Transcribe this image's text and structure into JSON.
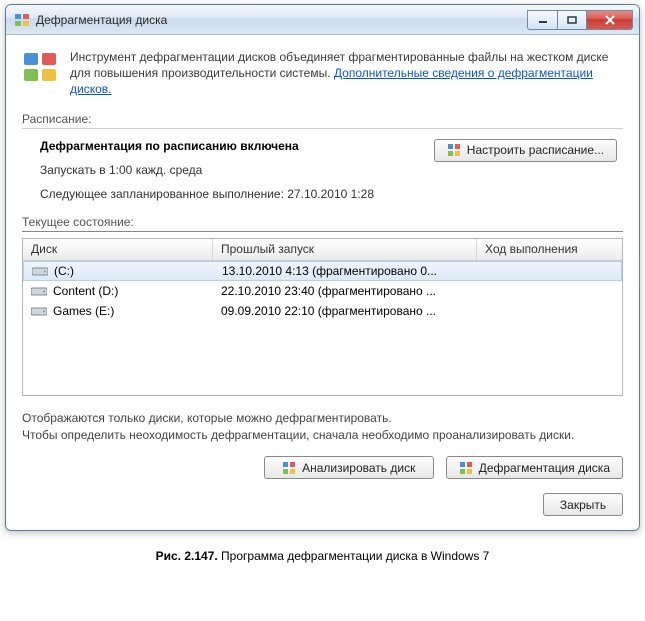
{
  "window": {
    "title": "Дефрагментация диска"
  },
  "intro": {
    "text": "Инструмент дефрагментации дисков объединяет фрагментированные файлы на жестком диске для повышения производительности системы. ",
    "link": "Дополнительные сведения о дефрагментации дисков."
  },
  "schedule": {
    "section_label": "Расписание:",
    "title": "Дефрагментация по расписанию включена",
    "run_line": "Запускать в 1:00 кажд. среда",
    "next_line": "Следующее запланированное выполнение: 27.10.2010 1:28",
    "config_button": "Настроить расписание..."
  },
  "status": {
    "section_label": "Текущее состояние:",
    "columns": {
      "disk": "Диск",
      "last": "Прошлый запуск",
      "progress": "Ход выполнения"
    },
    "rows": [
      {
        "name": "(C:)",
        "icon": "drive",
        "last": "13.10.2010 4:13 (фрагментировано 0...",
        "progress": "",
        "selected": true
      },
      {
        "name": "Content (D:)",
        "icon": "drive",
        "last": "22.10.2010 23:40 (фрагментировано ...",
        "progress": "",
        "selected": false
      },
      {
        "name": "Games (E:)",
        "icon": "drive",
        "last": "09.09.2010 22:10 (фрагментировано ...",
        "progress": "",
        "selected": false
      }
    ]
  },
  "hint": {
    "line1": "Отображаются только диски, которые можно дефрагментировать.",
    "line2": "Чтобы определить неоходимость  дефрагментации, сначала необходимо проанализировать диски."
  },
  "buttons": {
    "analyze": "Анализировать диск",
    "defrag": "Дефрагментация диска",
    "close": "Закрыть"
  },
  "caption": {
    "label": "Рис. 2.147.",
    "text": " Программа дефрагментации диска в Windows 7"
  }
}
